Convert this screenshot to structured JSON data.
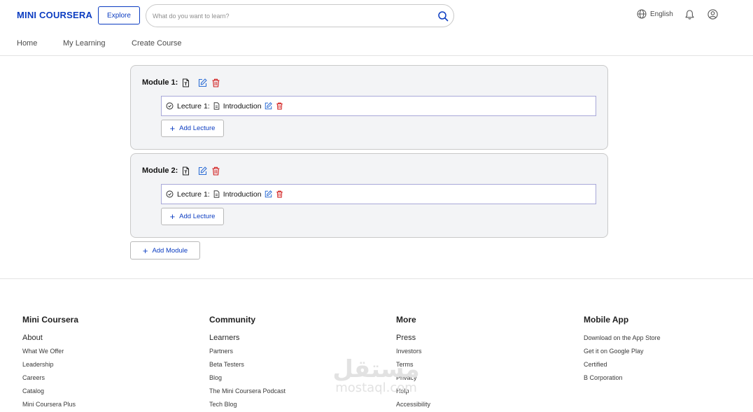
{
  "header": {
    "logo": "MINI COURSERA",
    "explore_label": "Explore",
    "search_placeholder": "What do you want to learn?",
    "language": "English"
  },
  "nav": {
    "items": [
      "Home",
      "My Learning",
      "Create Course"
    ]
  },
  "modules": [
    {
      "title": "Module 1:",
      "lectures": [
        {
          "label": "Lecture 1:",
          "name": "Introduction"
        }
      ],
      "add_lecture_label": "Add Lecture"
    },
    {
      "title": "Module 2:",
      "lectures": [
        {
          "label": "Lecture 1:",
          "name": "Introduction"
        }
      ],
      "add_lecture_label": "Add Lecture"
    }
  ],
  "add_module_label": "Add Module",
  "footer": {
    "columns": [
      {
        "heading": "Mini Coursera",
        "items": [
          "About",
          "What We Offer",
          "Leadership",
          "Careers",
          "Catalog",
          "Mini Coursera Plus"
        ]
      },
      {
        "heading": "Community",
        "items": [
          "Learners",
          "Partners",
          "Beta Testers",
          "Blog",
          "The Mini Coursera Podcast",
          "Tech Blog"
        ]
      },
      {
        "heading": "More",
        "items": [
          "Press",
          "Investors",
          "Terms",
          "Privacy",
          "Help",
          "Accessibility"
        ]
      },
      {
        "heading": "Mobile App",
        "items": [
          "Download on the App Store",
          "Get it on Google Play",
          "Certified",
          "B Corporation"
        ]
      }
    ]
  },
  "watermark": {
    "arabic": "مستقل",
    "latin": "mostaql.com"
  },
  "colors": {
    "brand": "#0b3cc1",
    "edit_icon": "#2f6fd6",
    "delete_icon": "#d11a1a",
    "module_bg": "#f3f4f6",
    "lecture_border": "#a8a8d8"
  },
  "icons": {
    "module_file": "file-text-icon",
    "edit": "edit-icon",
    "delete": "trash-icon",
    "lecture_status": "check-circle-icon",
    "lecture_file": "file-icon",
    "add": "plus-icon",
    "language": "globe-icon",
    "notifications": "bell-icon",
    "account": "user-circle-icon",
    "search": "search-icon"
  }
}
